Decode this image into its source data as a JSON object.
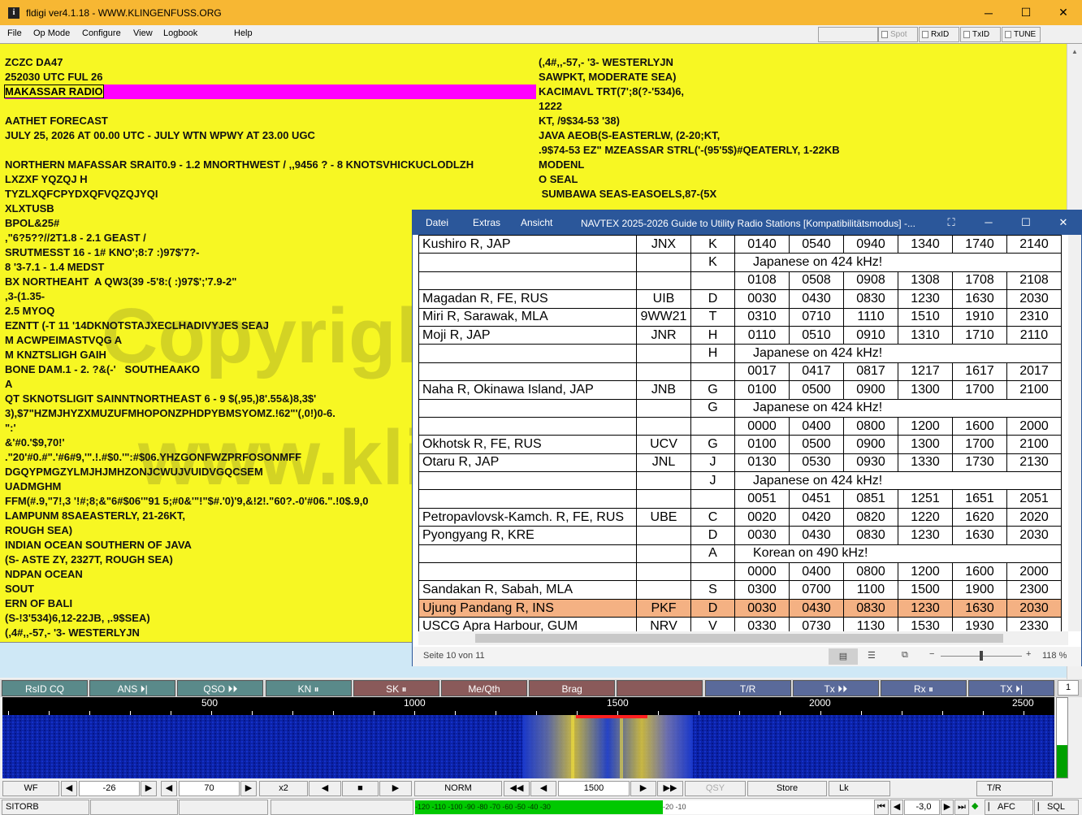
{
  "window": {
    "title": "fldigi ver4.1.18 - WWW.KLINGENFUSS.ORG",
    "minimize": "─",
    "maximize": "☐",
    "close": "✕"
  },
  "menu": {
    "items": [
      "File",
      "Op Mode",
      "Configure",
      "View",
      "Logbook",
      "Help"
    ],
    "spot": "Spot",
    "rxid": "RxID",
    "txid": "TxID",
    "tune": "TUNE"
  },
  "rx": {
    "left_lines": [
      "ZCZC DA47",
      "252030 UTC FUL 26",
      "MAKASSAR RADIO",
      "",
      "AATHET FORECAST",
      "JULY 25, 2026 AT 00.00 UTC - JULY WTN WPWY AT 23.00 UGC",
      "",
      "NORTHERN MAFASSAR SRAIT0.9 - 1.2 MNORTHWEST / ,,9456 ? - 8 KNOTSVHICKUCLODLZH",
      "LXZXF YQZQJ H",
      "TYZLXQFCPYDXQFVQZQJYQI",
      "XLXTUSB",
      "BPOL&25#",
      ",\"6?5??//2T1.8 - 2.1 GEAST /",
      "SRUTMESST 16 - 1# KNO';8:7 :)97$'7?-",
      "8 '3-7.1 - 1.4 MEDST",
      "BX NORTHEAHT  A QW3(39 -5'8:( :)97$';'7.9-2\"",
      ",3-(1.35-",
      "2.5 MYOQ",
      "EZNTT (-T 11 '14DKNOTSTAJXECLHADIVYJES SEAJ",
      "M ACWPEIMASTVQG A",
      "M KNZTSLIGH GAIH",
      "BONE DAM.1 - 2. ?&(-'   SOUTHEAAKO",
      "A",
      "QT SKNOTSLIGIT SAINNTNORTHEAST 6 - 9 $(,95,)8'.55&)8,3$'",
      "3),$7\"HZMJHYZXMUZUFMHOPONZPHDPYBMSYOMZ.!62\"'(,0!)0-6.",
      "\":'",
      "&'#0.'$9,70!'",
      ".\"20'#0.#\".'#6#9,'\".!.#$0.'\":#$06.YHZGONFWZPRFOSONMFF",
      "DGQYPMGZYLMJHJMHZONJCWUJVUIDVGQCSEM",
      "UADMGHM",
      "FFM(#.9,\"7!,3 '!#;8;&\"6#$06'\"91 5;#0&'\"!\"$#.'0)'9,&!2!.\"60?.-0'#06.\".!0$.9,0",
      "LAMPUNM 8SAEASTERLY, 21-26KT,",
      "ROUGH SEA)",
      "INDIAN OCEAN SOUTHERN OF JAVA",
      "(S- ASTE ZY, 2327T, ROUGH SEA)",
      "NDPAN OCEAN",
      "SOUT",
      "ERN OF BALI",
      "(S-!3'534)6,12-22JB, ,.9$SEA)",
      "(,4#,,-57,- '3- WESTERLYJN"
    ],
    "right_lines": [
      "(,4#,,-57,- '3- WESTERLYJN",
      "SAWPKT, MODERATE SEA)",
      "KACIMAVL TRT(7';8(?-'534)6,",
      "1222",
      "KT, /9$34-53 '38)",
      "JAVA AEOB(S-EASTERLW, (2-20;KT,",
      ".9$74-53 EZ\" MZEASSAR STRL('-(95'5$)#QEATERLY, 1-22KB",
      "MODENL",
      "O SEAL",
      " SUMBAWA SEAS-EASOELS,87-(5X"
    ],
    "watermark": "Copyright © 2026 www.klingenfuss.org"
  },
  "word": {
    "menu": [
      "Datei",
      "Extras",
      "Ansicht"
    ],
    "title": "NAVTEX 2025-2026 Guide to Utility Radio Stations [Kompatibilitätsmodus] -...",
    "status_page": "Seite 10 von 11",
    "zoom": "118 %",
    "rows": [
      [
        "Kushiro R, JAP",
        "JNX",
        "K",
        "0140",
        "0540",
        "0940",
        "1340",
        "1740",
        "2140"
      ],
      [
        "",
        "",
        "K",
        "Japanese on 424 kHz!"
      ],
      [
        "",
        "",
        "",
        "0108",
        "0508",
        "0908",
        "1308",
        "1708",
        "2108"
      ],
      [
        "Magadan R, FE, RUS",
        "UIB",
        "D",
        "0030",
        "0430",
        "0830",
        "1230",
        "1630",
        "2030"
      ],
      [
        "Miri R, Sarawak, MLA",
        "9WW21",
        "T",
        "0310",
        "0710",
        "1110",
        "1510",
        "1910",
        "2310"
      ],
      [
        "Moji R, JAP",
        "JNR",
        "H",
        "0110",
        "0510",
        "0910",
        "1310",
        "1710",
        "2110"
      ],
      [
        "",
        "",
        "H",
        "Japanese on 424 kHz!"
      ],
      [
        "",
        "",
        "",
        "0017",
        "0417",
        "0817",
        "1217",
        "1617",
        "2017"
      ],
      [
        "Naha R, Okinawa Island, JAP",
        "JNB",
        "G",
        "0100",
        "0500",
        "0900",
        "1300",
        "1700",
        "2100"
      ],
      [
        "",
        "",
        "G",
        "Japanese on 424 kHz!"
      ],
      [
        "",
        "",
        "",
        "0000",
        "0400",
        "0800",
        "1200",
        "1600",
        "2000"
      ],
      [
        "Okhotsk R, FE, RUS",
        "UCV",
        "G",
        "0100",
        "0500",
        "0900",
        "1300",
        "1700",
        "2100"
      ],
      [
        "Otaru R, JAP",
        "JNL",
        "J",
        "0130",
        "0530",
        "0930",
        "1330",
        "1730",
        "2130"
      ],
      [
        "",
        "",
        "J",
        "Japanese on 424 kHz!"
      ],
      [
        "",
        "",
        "",
        "0051",
        "0451",
        "0851",
        "1251",
        "1651",
        "2051"
      ],
      [
        "Petropavlovsk-Kamch. R, FE, RUS",
        "UBE",
        "C",
        "0020",
        "0420",
        "0820",
        "1220",
        "1620",
        "2020"
      ],
      [
        "Pyongyang R, KRE",
        "",
        "D",
        "0030",
        "0430",
        "0830",
        "1230",
        "1630",
        "2030"
      ],
      [
        "",
        "",
        "A",
        "Korean on 490 kHz!"
      ],
      [
        "",
        "",
        "",
        "0000",
        "0400",
        "0800",
        "1200",
        "1600",
        "2000"
      ],
      [
        "Sandakan R, Sabah, MLA",
        "",
        "S",
        "0300",
        "0700",
        "1100",
        "1500",
        "1900",
        "2300"
      ],
      [
        "Ujung Pandang R, INS",
        "PKF",
        "D",
        "0030",
        "0430",
        "0830",
        "1230",
        "1630",
        "2030"
      ],
      [
        "USCG Apra Harbour, GUM",
        "NRV",
        "V",
        "0330",
        "0730",
        "1130",
        "1530",
        "1930",
        "2330"
      ]
    ],
    "highlight_row": 20
  },
  "macros": {
    "items": [
      "RsID CQ",
      "ANS ⏵|",
      "QSO ⏵⏵",
      "KN ⏸",
      "SK ⏸",
      "Me/Qth",
      "Brag",
      "",
      "T/R",
      "Tx ⏵⏵",
      "Rx ⏸",
      "TX ⏵|"
    ],
    "page": "1"
  },
  "scale": {
    "labels": [
      "500",
      "1000",
      "1500",
      "2000",
      "2500"
    ]
  },
  "controls": {
    "wf": "WF",
    "level": "-26",
    "range": "70",
    "zoom": "x2",
    "speed": "NORM",
    "freq": "1500",
    "qsy": "QSY",
    "store": "Store",
    "lk": "Lk",
    "tr": "T/R"
  },
  "status": {
    "mode": "SITORB",
    "meter_scale": "-120 -110 -100 -90 -80 -70 -60 -50 -40 -30",
    "meter_scale2": "-20 -10",
    "afc_value": "-3,0",
    "afc": "AFC",
    "sql": "SQL"
  }
}
